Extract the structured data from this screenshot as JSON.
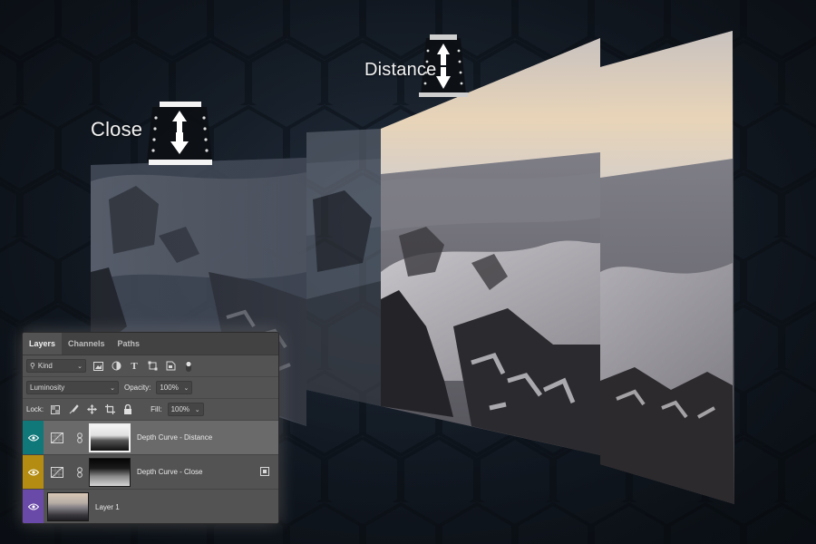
{
  "labels": {
    "close": "Close",
    "distance": "Distance"
  },
  "colors": {
    "background": "#18212d",
    "panel": "#535353",
    "eye_teal": "#11787a",
    "eye_gold": "#b38c11",
    "eye_purple": "#6a4aa8",
    "selected_row": "#6a6a6a"
  },
  "panel": {
    "tabs": [
      {
        "label": "Layers",
        "active": true
      },
      {
        "label": "Channels",
        "active": false
      },
      {
        "label": "Paths",
        "active": false
      }
    ],
    "filter": {
      "kind_label": "Kind",
      "icons": [
        "image-filter-icon",
        "adjustment-filter-icon",
        "type-filter-icon",
        "shape-filter-icon",
        "smart-object-filter-icon",
        "filter-toggle-icon"
      ]
    },
    "blend_mode": "Luminosity",
    "opacity": {
      "label": "Opacity:",
      "value": "100%"
    },
    "lock": {
      "label": "Lock:",
      "icons": [
        "lock-transparent-icon",
        "lock-image-icon",
        "lock-position-icon",
        "lock-artboard-icon",
        "lock-all-icon"
      ]
    },
    "fill": {
      "label": "Fill:",
      "value": "100%"
    },
    "layers": [
      {
        "name": "Depth Curve -  Distance",
        "eye_color": "#11787a",
        "selected": true,
        "type": "curves"
      },
      {
        "name": "Depth Curve - Close",
        "eye_color": "#b38c11",
        "selected": false,
        "type": "curves"
      },
      {
        "name": "Layer 1",
        "eye_color": "#6a4aa8",
        "selected": false,
        "type": "pixel"
      }
    ]
  }
}
